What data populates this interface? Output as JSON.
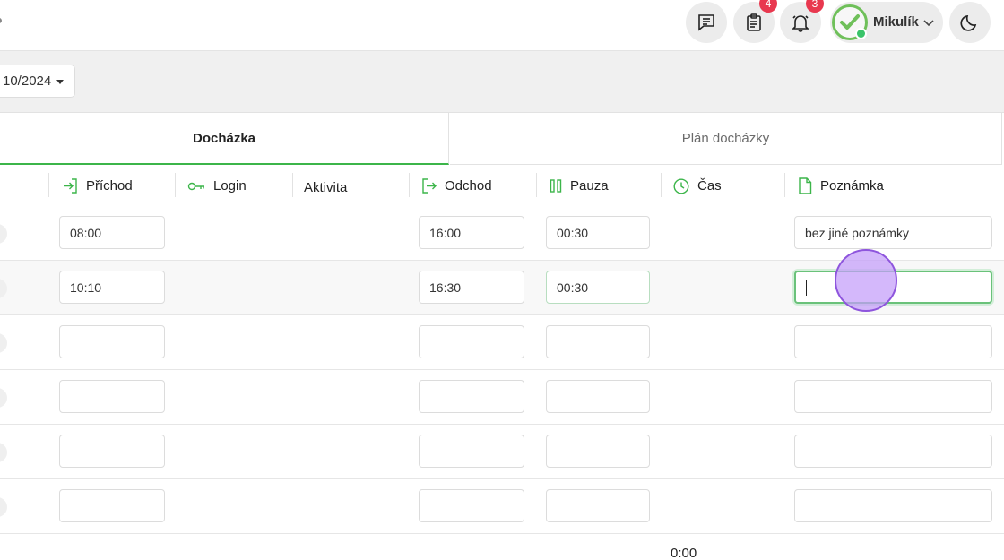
{
  "header": {
    "messages_icon": "message-list-icon",
    "tasks": {
      "icon": "clipboard-icon",
      "badge": "4"
    },
    "notifications": {
      "icon": "bell-icon",
      "badge": "3"
    },
    "user": {
      "name": "Mikulík",
      "status": "online"
    },
    "theme_icon": "moon-icon"
  },
  "period": {
    "value": "10/2024"
  },
  "tabs": [
    {
      "label": "Docházka",
      "active": true
    },
    {
      "label": "Plán docházky",
      "active": false
    }
  ],
  "columns": {
    "prichod": "Příchod",
    "login": "Login",
    "aktivita": "Aktivita",
    "odchod": "Odchod",
    "pauza": "Pauza",
    "cas": "Čas",
    "poznamka": "Poznámka"
  },
  "rows": [
    {
      "prichod": "08:00",
      "odchod": "16:00",
      "pauza": "00:30",
      "poznamka": "bez jiné poznámky"
    },
    {
      "prichod": "10:10",
      "odchod": "16:30",
      "pauza": "00:30",
      "poznamka": ""
    },
    {
      "prichod": "",
      "odchod": "",
      "pauza": "",
      "poznamka": ""
    },
    {
      "prichod": "",
      "odchod": "",
      "pauza": "",
      "poznamka": ""
    },
    {
      "prichod": "",
      "odchod": "",
      "pauza": "",
      "poznamka": ""
    },
    {
      "prichod": "",
      "odchod": "",
      "pauza": "",
      "poznamka": ""
    }
  ],
  "total": "0:00",
  "colors": {
    "accent": "#3cb54a",
    "badge": "#e8384f",
    "click_marker": "#c49cfa"
  }
}
